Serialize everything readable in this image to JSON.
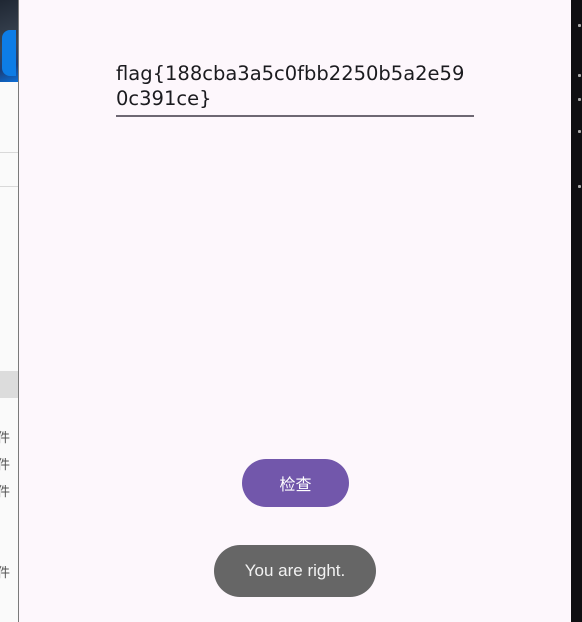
{
  "background_window": {
    "side_labels": [
      "件",
      "件",
      "件",
      "件"
    ]
  },
  "app": {
    "flag_input": {
      "value": "flag{188cba3a5c0fbb2250b5a2e590c391ce}"
    },
    "check_button": {
      "label": "检查"
    },
    "toast": {
      "message": "You are right."
    }
  },
  "colors": {
    "app_background": "#fdf7fc",
    "button": "#7257ab",
    "toast": "#666666",
    "underline": "#6e6873"
  }
}
